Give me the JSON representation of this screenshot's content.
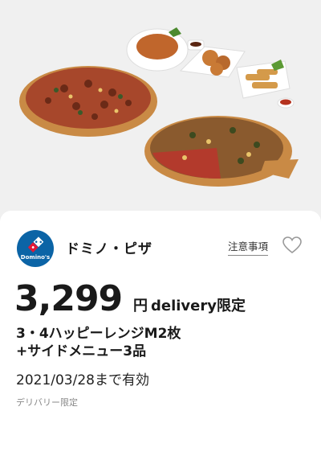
{
  "hero": {
    "image_label": "pizza-and-sides-photo"
  },
  "coupon": {
    "brand_name": "ドミノ・ピザ",
    "logo_text": "Domino's",
    "notice_label": "注意事項",
    "price": "3,299",
    "yen": "円",
    "delivery_label": "delivery限定",
    "desc_line1": "3・4ハッピーレンジM2枚",
    "desc_line2": "+サイドメニュー3品",
    "expiry": "2021/03/28まで有効",
    "restriction": "デリバリー限定"
  },
  "colors": {
    "domino_blue": "#0b64a6",
    "domino_red": "#e31837",
    "heart_stroke": "#999999"
  },
  "icons": {
    "favorite": "heart-icon",
    "logo": "dominos-logo"
  }
}
